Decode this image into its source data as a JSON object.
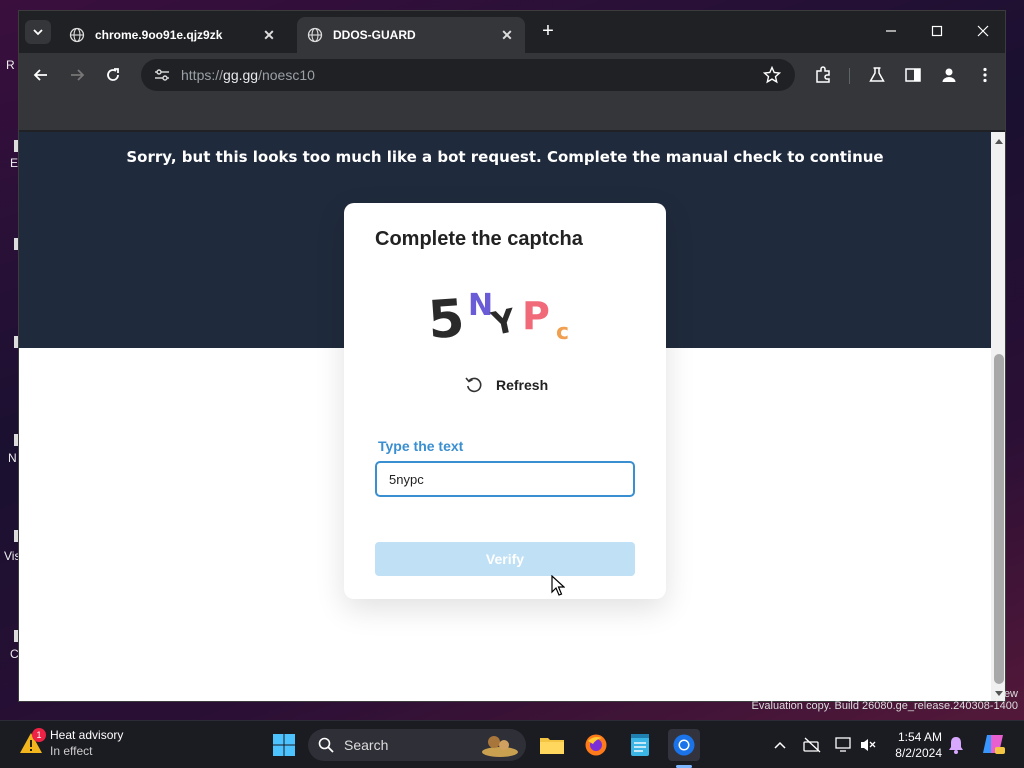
{
  "desktop": {
    "fragments": [
      "R",
      "E",
      "N",
      "Vis",
      "C"
    ]
  },
  "browser": {
    "tabs": [
      {
        "title": "chrome.9oo91e.qjz9zk",
        "active": false
      },
      {
        "title": "DDOS-GUARD",
        "active": true
      }
    ],
    "new_tab_label": "+",
    "url_prefix": "https://",
    "url_host": "gg.gg",
    "url_path": "/noesc10",
    "icons": [
      "tab-search-icon",
      "globe-icon",
      "close-icon",
      "back-icon",
      "forward-icon",
      "reload-icon",
      "site-info-icon",
      "star-icon",
      "extensions-icon",
      "labs-icon",
      "side-panel-icon",
      "profile-icon",
      "menu-icon",
      "minimize-icon",
      "maximize-icon",
      "window-close-icon"
    ]
  },
  "page": {
    "banner_text": "Sorry, but this looks too much like a bot request. Complete the manual check to continue",
    "card_title": "Complete the captcha",
    "captcha_chars": [
      "5",
      "N",
      "Y",
      "P",
      "c"
    ],
    "refresh_label": "Refresh",
    "field_label": "Type the text",
    "input_value": "5nypc",
    "verify_label": "Verify"
  },
  "watermark": {
    "line1": "ew",
    "line2": "Evaluation copy. Build 26080.ge_release.240308-1400"
  },
  "taskbar": {
    "weather_title": "Heat advisory",
    "weather_sub": "In effect",
    "weather_badge": "1",
    "search_label": "Search",
    "time": "1:54 AM",
    "date": "8/2/2024"
  }
}
